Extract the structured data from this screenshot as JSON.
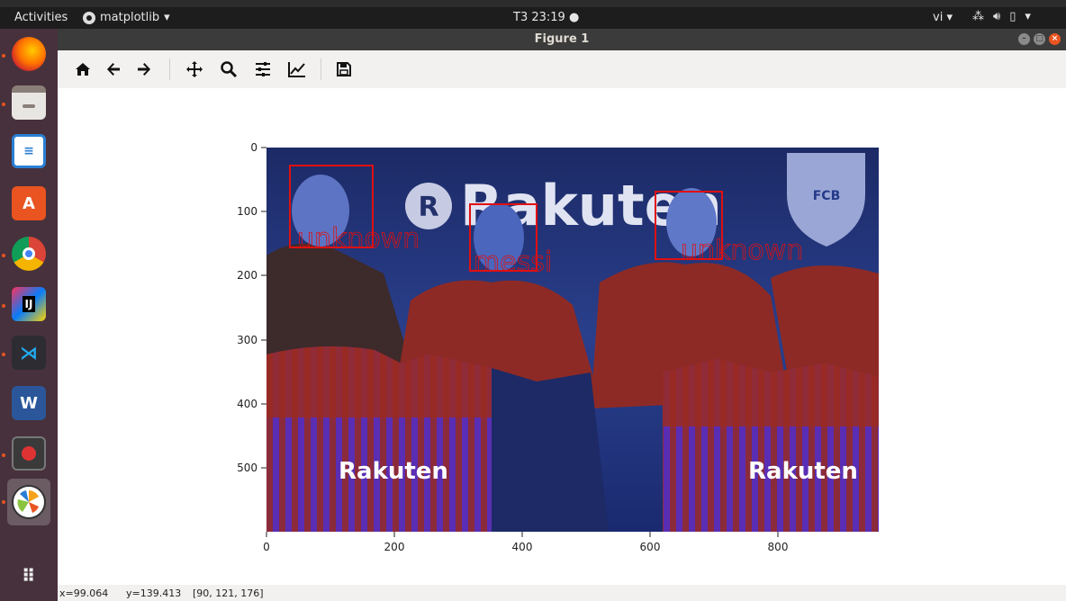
{
  "topbar": {
    "activities": "Activities",
    "app_name": "matplotlib",
    "clock": "T3 23:19",
    "lang": "vi"
  },
  "window": {
    "title": "Figure 1"
  },
  "toolbar": {
    "buttons": [
      "home-icon",
      "back-arrow-icon",
      "forward-arrow-icon",
      "pan-icon",
      "zoom-icon",
      "subplots-icon",
      "edit-axis-icon",
      "save-icon"
    ]
  },
  "plot": {
    "x_ticks": [
      "0",
      "200",
      "400",
      "600",
      "800"
    ],
    "y_ticks": [
      "0",
      "100",
      "200",
      "300",
      "400",
      "500"
    ],
    "faces": [
      {
        "label": "unknown"
      },
      {
        "label": "messi"
      },
      {
        "label": "unknown"
      }
    ],
    "sponsor_text": "Rakuten",
    "banner_text": "Rakuten",
    "crest_text": "FCB"
  },
  "statusbar": {
    "x": "x=99.064",
    "y": "y=139.413",
    "pixel": "[90, 121, 176]"
  },
  "dock": {
    "items": [
      "firefox-icon",
      "files-icon",
      "writer-icon",
      "software-icon",
      "chrome-icon",
      "intellij-icon",
      "vscode-icon",
      "word-icon",
      "remote-icon",
      "matplotlib-icon",
      "apps-grid-icon"
    ]
  },
  "colors": {
    "accent": "#e95420",
    "box": "#e01010",
    "dock": "#47313c"
  }
}
